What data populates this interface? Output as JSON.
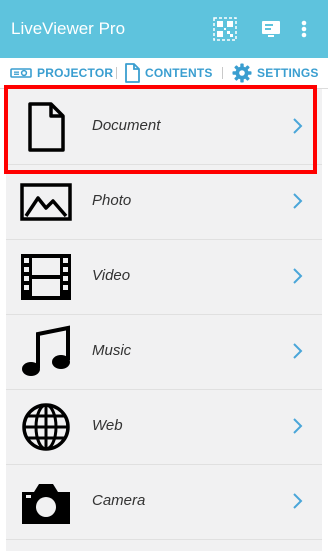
{
  "app": {
    "title": "LiveViewer Pro",
    "accent_color": "#5ec3dd",
    "icons": [
      "qr-code-icon",
      "screen-share-icon",
      "overflow-menu-icon"
    ]
  },
  "tabs": [
    {
      "label": "PROJECTOR",
      "icon": "projector-icon"
    },
    {
      "label": "CONTENTS",
      "icon": "document-icon"
    },
    {
      "label": "SETTINGS",
      "icon": "gear-icon"
    }
  ],
  "list": {
    "items": [
      {
        "label": "Document",
        "icon": "document-icon"
      },
      {
        "label": "Photo",
        "icon": "photo-icon"
      },
      {
        "label": "Video",
        "icon": "film-icon"
      },
      {
        "label": "Music",
        "icon": "music-note-icon"
      },
      {
        "label": "Web",
        "icon": "globe-icon"
      },
      {
        "label": "Camera",
        "icon": "camera-icon"
      }
    ],
    "highlighted_item": "Document",
    "highlight_color": "#ff0000"
  }
}
